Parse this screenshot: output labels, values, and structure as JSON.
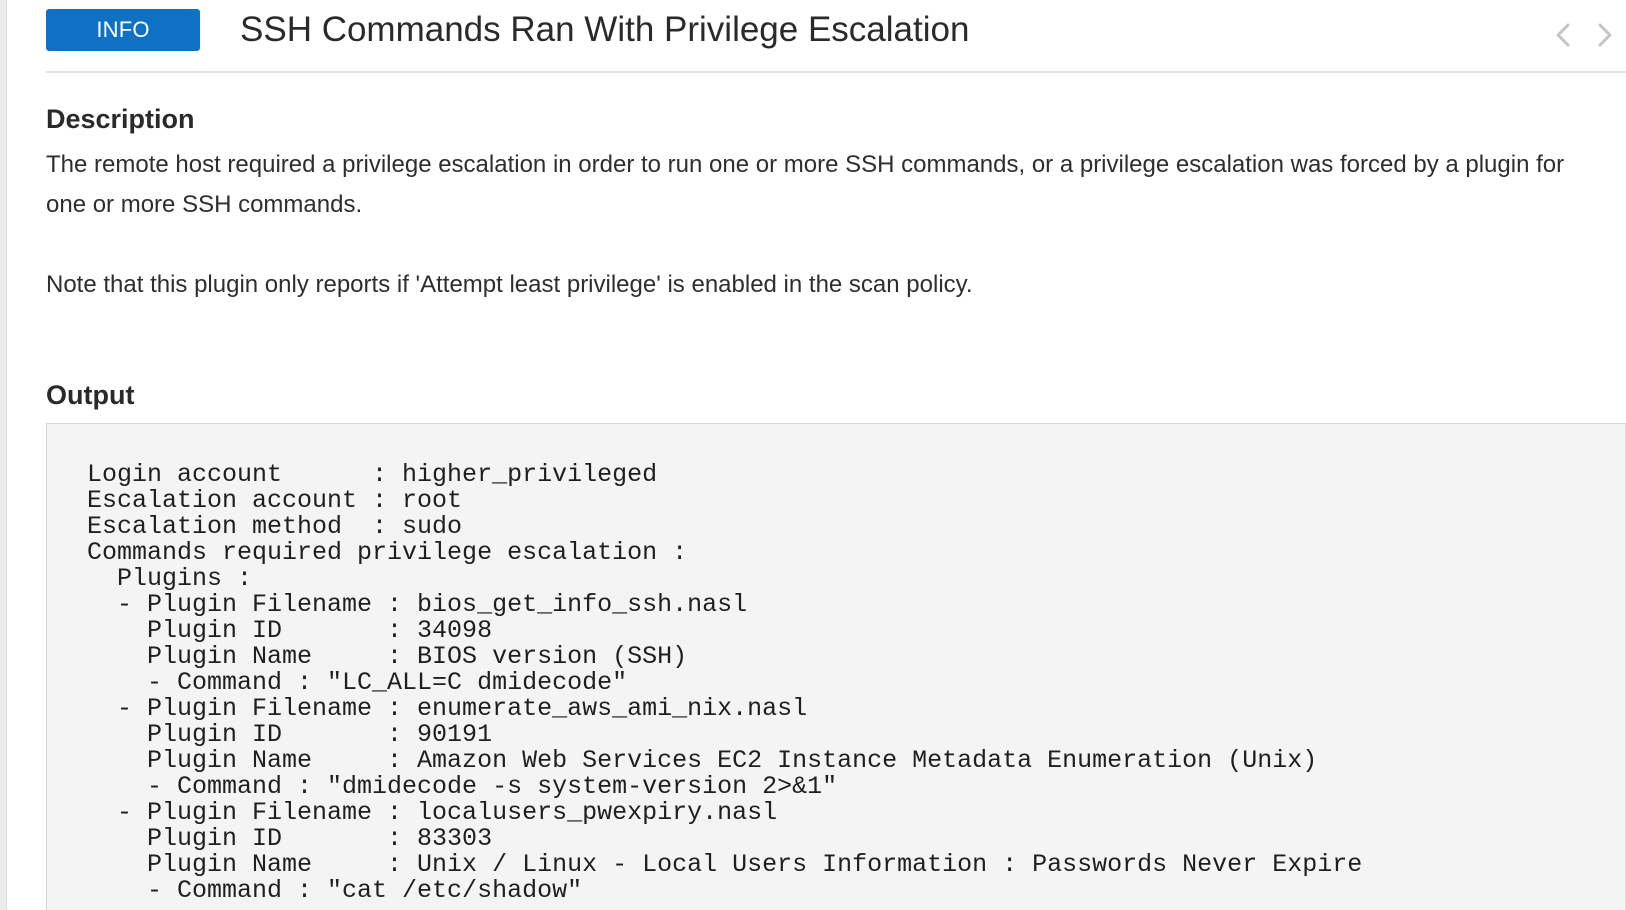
{
  "header": {
    "severity": "INFO",
    "severity_color": "#0f71c3",
    "title": "SSH Commands Ran With Privilege Escalation",
    "prev_icon": "chevron-left-icon",
    "next_icon": "chevron-right-icon"
  },
  "description": {
    "heading": "Description",
    "paragraphs": [
      "The remote host required a privilege escalation in order to run one or more SSH commands, or a privilege escalation was forced by a plugin for one or more SSH commands.",
      "Note that this plugin only reports if 'Attempt least privilege' is enabled in the scan policy."
    ]
  },
  "output": {
    "heading": "Output",
    "lines": [
      "Login account      : higher_privileged",
      "Escalation account : root",
      "Escalation method  : sudo",
      "Commands required privilege escalation :",
      "  Plugins :",
      "  - Plugin Filename : bios_get_info_ssh.nasl",
      "    Plugin ID       : 34098",
      "    Plugin Name     : BIOS version (SSH)",
      "    - Command : \"LC_ALL=C dmidecode\"",
      "  - Plugin Filename : enumerate_aws_ami_nix.nasl",
      "    Plugin ID       : 90191",
      "    Plugin Name     : Amazon Web Services EC2 Instance Metadata Enumeration (Unix)",
      "    - Command : \"dmidecode -s system-version 2>&1\"",
      "  - Plugin Filename : localusers_pwexpiry.nasl",
      "    Plugin ID       : 83303",
      "    Plugin Name     : Unix / Linux - Local Users Information : Passwords Never Expire",
      "    - Command : \"cat /etc/shadow\""
    ]
  }
}
